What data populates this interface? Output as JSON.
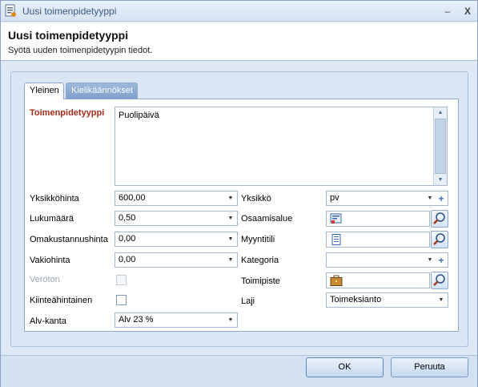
{
  "window": {
    "title": "Uusi toimenpidetyyppi",
    "minimize_glyph": "–",
    "close_glyph": "X"
  },
  "header": {
    "title": "Uusi toimenpidetyyppi",
    "subtitle": "Syötä uuden toimenpidetyypin tiedot."
  },
  "tabs": [
    {
      "label": "Yleinen",
      "active": true
    },
    {
      "label": "Kielikäännökset",
      "active": false
    }
  ],
  "form": {
    "toimenpidetyyppi": {
      "label": "Toimenpidetyyppi",
      "value": "Puolipäivä"
    },
    "yksikkohinta": {
      "label": "Yksikköhinta",
      "value": "600,00"
    },
    "lukumaara": {
      "label": "Lukumäärä",
      "value": "0,50"
    },
    "omakustannushinta": {
      "label": "Omakustannushinta",
      "value": "0,00"
    },
    "vakiohinta": {
      "label": "Vakiohinta",
      "value": "0,00"
    },
    "veroton": {
      "label": "Veroton",
      "checked": false,
      "disabled": true
    },
    "kiinteahintainen": {
      "label": "Kiinteähintainen",
      "checked": false
    },
    "alv_kanta": {
      "label": "Alv-kanta",
      "value": "Alv 23 %"
    },
    "yksikko": {
      "label": "Yksikkö",
      "value": "pv"
    },
    "osaamisalue": {
      "label": "Osaamisalue",
      "value": "",
      "icon": "form-icon"
    },
    "myyntitili": {
      "label": "Myyntitili",
      "value": "",
      "icon": "document-icon"
    },
    "kategoria": {
      "label": "Kategoria",
      "value": ""
    },
    "toimipiste": {
      "label": "Toimipiste",
      "value": "",
      "icon": "briefcase-icon"
    },
    "laji": {
      "label": "Laji",
      "value": "Toimeksianto"
    }
  },
  "buttons": {
    "ok": "OK",
    "cancel": "Peruuta"
  },
  "colors": {
    "required_label": "#a52a1a",
    "window_bg": "#dfe8f5",
    "tab_inactive": "#7fa0cb"
  }
}
